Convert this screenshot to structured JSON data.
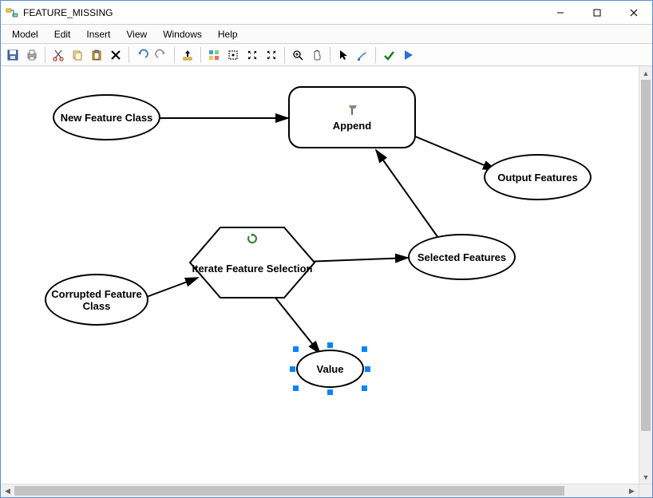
{
  "window": {
    "title": "FEATURE_MISSING"
  },
  "menus": [
    "Model",
    "Edit",
    "Insert",
    "View",
    "Windows",
    "Help"
  ],
  "toolbar_icons": [
    "save-icon",
    "print-icon",
    "sep",
    "cut-icon",
    "copy-icon",
    "paste-icon",
    "delete-icon",
    "sep",
    "undo-icon",
    "redo-icon",
    "sep",
    "add-data-icon",
    "sep",
    "auto-layout-icon",
    "full-extent-icon",
    "fixed-zoom-in-icon",
    "fixed-zoom-out-icon",
    "sep",
    "zoom-in-icon",
    "pan-icon",
    "sep",
    "select-icon",
    "connect-icon",
    "sep",
    "validate-icon",
    "run-icon"
  ],
  "nodes": {
    "new_feature_class": "New Feature Class",
    "append": "Append",
    "output_features": "Output Features",
    "iterate_feature_selection": "Iterate Feature Selection",
    "selected_features": "Selected Features",
    "corrupted_feature_class": "Corrupted Feature Class",
    "value": "Value"
  },
  "selected_node": "value"
}
